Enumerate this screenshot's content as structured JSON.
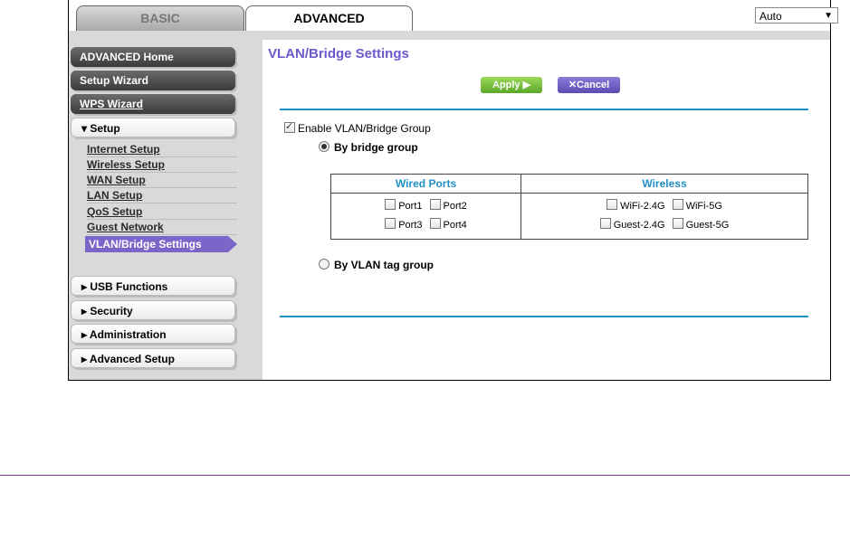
{
  "tabs": {
    "basic": "BASIC",
    "advanced": "ADVANCED"
  },
  "language": {
    "selected": "Auto"
  },
  "sidebar": {
    "advanced_home": "ADVANCED Home",
    "setup_wizard": "Setup Wizard",
    "wps_wizard": "WPS Wizard",
    "setup": "▾ Setup",
    "setup_items": [
      "Internet Setup",
      "Wireless Setup",
      "WAN Setup",
      "LAN Setup",
      "QoS Setup",
      "Guest Network",
      "VLAN/Bridge Settings"
    ],
    "usb": "▸ USB Functions",
    "security": "▸ Security",
    "administration": "▸ Administration",
    "advanced_setup": "▸ Advanced Setup"
  },
  "main": {
    "title": "VLAN/Bridge Settings",
    "apply": "Apply ▶",
    "cancel": "✕Cancel",
    "enable_label": "Enable VLAN/Bridge Group",
    "by_bridge_group": "By bridge group",
    "by_vlan_tag_group": "By VLAN tag group",
    "wired_ports_header": "Wired Ports",
    "wireless_header": "Wireless",
    "ports": [
      "Port1",
      "Port2",
      "Port3",
      "Port4"
    ],
    "wireless_items": [
      "WiFi-2.4G",
      "WiFi-5G",
      "Guest-2.4G",
      "Guest-5G"
    ]
  },
  "colors": {
    "accent_blue": "#1f8fc7",
    "title_purple": "#6a5acd",
    "active_nav": "#7b65c8",
    "apply_green": "#5aa829"
  }
}
